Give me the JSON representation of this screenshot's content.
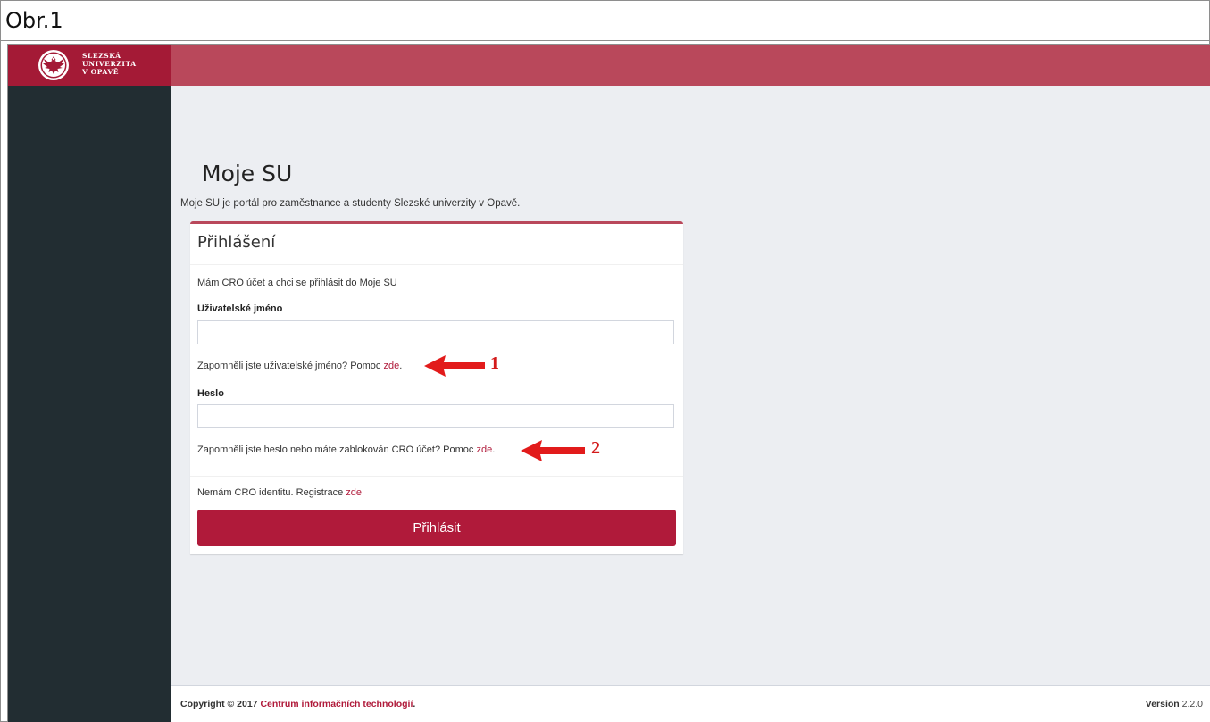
{
  "figure": {
    "caption": "Obr.1"
  },
  "brand": {
    "line1": "SLEZSKÁ",
    "line2": "UNIVERZITA",
    "line3": "V OPAVĚ",
    "emblem_icon": "eagle-emblem-icon"
  },
  "page": {
    "title": "Moje SU",
    "subtitle": "Moje SU je portál pro zaměstnance a studenty Slezské univerzity v Opavě."
  },
  "login": {
    "title": "Přihlášení",
    "intro": "Mám CRO účet a chci se přihlásit do Moje SU",
    "username_label": "Uživatelské jméno",
    "username_value": "",
    "forgot_username_text": "Zapomněli jste uživatelské jméno? Pomoc",
    "forgot_username_link": "zde",
    "password_label": "Heslo",
    "password_value": "",
    "forgot_password_text": "Zapomněli jste heslo nebo máte zablokován CRO účet? Pomoc",
    "forgot_password_link": "zde",
    "register_text": "Nemám CRO identitu. Registrace",
    "register_link": "zde",
    "submit_label": "Přihlásit",
    "period": "."
  },
  "annotations": {
    "arrow1_number": "1",
    "arrow2_number": "2",
    "arrow_color": "#e21b1b"
  },
  "footer": {
    "copyright_prefix": "Copyright © 2017",
    "copyright_link": "Centrum informačních technologií",
    "copyright_suffix": ".",
    "version_label": "Version",
    "version_value": "2.2.0"
  },
  "colors": {
    "topbar": "#b9485b",
    "brand_bg": "#a41a36",
    "sidebar": "#222d32",
    "content_bg": "#eceef2",
    "primary": "#b01a3a"
  }
}
